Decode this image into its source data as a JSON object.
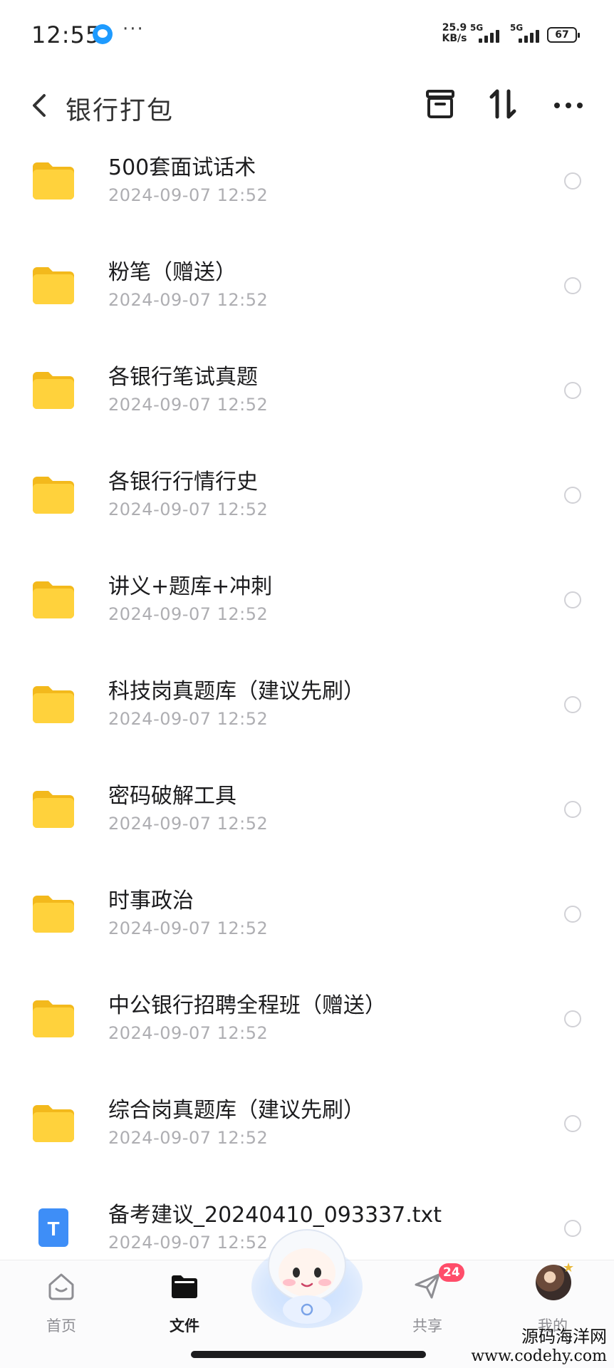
{
  "status_bar": {
    "time": "12:55",
    "more": "···",
    "net_speed_value": "25.9",
    "net_speed_unit": "KB/s",
    "signal1_label": "5G",
    "signal2_label": "5G",
    "battery": "67"
  },
  "header": {
    "title": "银行打包"
  },
  "files": [
    {
      "name": "500套面试话术",
      "date": "2024-09-07  12:52",
      "type": "folder"
    },
    {
      "name": "粉笔（赠送）",
      "date": "2024-09-07  12:52",
      "type": "folder"
    },
    {
      "name": "各银行笔试真题",
      "date": "2024-09-07  12:52",
      "type": "folder"
    },
    {
      "name": "各银行行情行史",
      "date": "2024-09-07  12:52",
      "type": "folder"
    },
    {
      "name": "讲义+题库+冲刺",
      "date": "2024-09-07  12:52",
      "type": "folder"
    },
    {
      "name": "科技岗真题库（建议先刷）",
      "date": "2024-09-07  12:52",
      "type": "folder"
    },
    {
      "name": "密码破解工具",
      "date": "2024-09-07  12:52",
      "type": "folder"
    },
    {
      "name": "时事政治",
      "date": "2024-09-07  12:52",
      "type": "folder"
    },
    {
      "name": "中公银行招聘全程班（赠送）",
      "date": "2024-09-07  12:52",
      "type": "folder"
    },
    {
      "name": "综合岗真题库（建议先刷）",
      "date": "2024-09-07  12:52",
      "type": "folder"
    },
    {
      "name": "备考建议_20240410_093337.txt",
      "date": "2024-09-07  12:52",
      "type": "txt",
      "icon_letter": "T"
    }
  ],
  "bottom_nav": {
    "home": "首页",
    "files": "文件",
    "share": "共享",
    "share_badge": "24",
    "mine": "我的"
  },
  "watermark": {
    "line1": "源码海洋网",
    "line2": "www.codehy.com"
  },
  "colors": {
    "folder": "#ffd23c",
    "txt_icon": "#3e8ef7",
    "badge": "#ff4d6a",
    "date_text": "#aeaeb2"
  }
}
